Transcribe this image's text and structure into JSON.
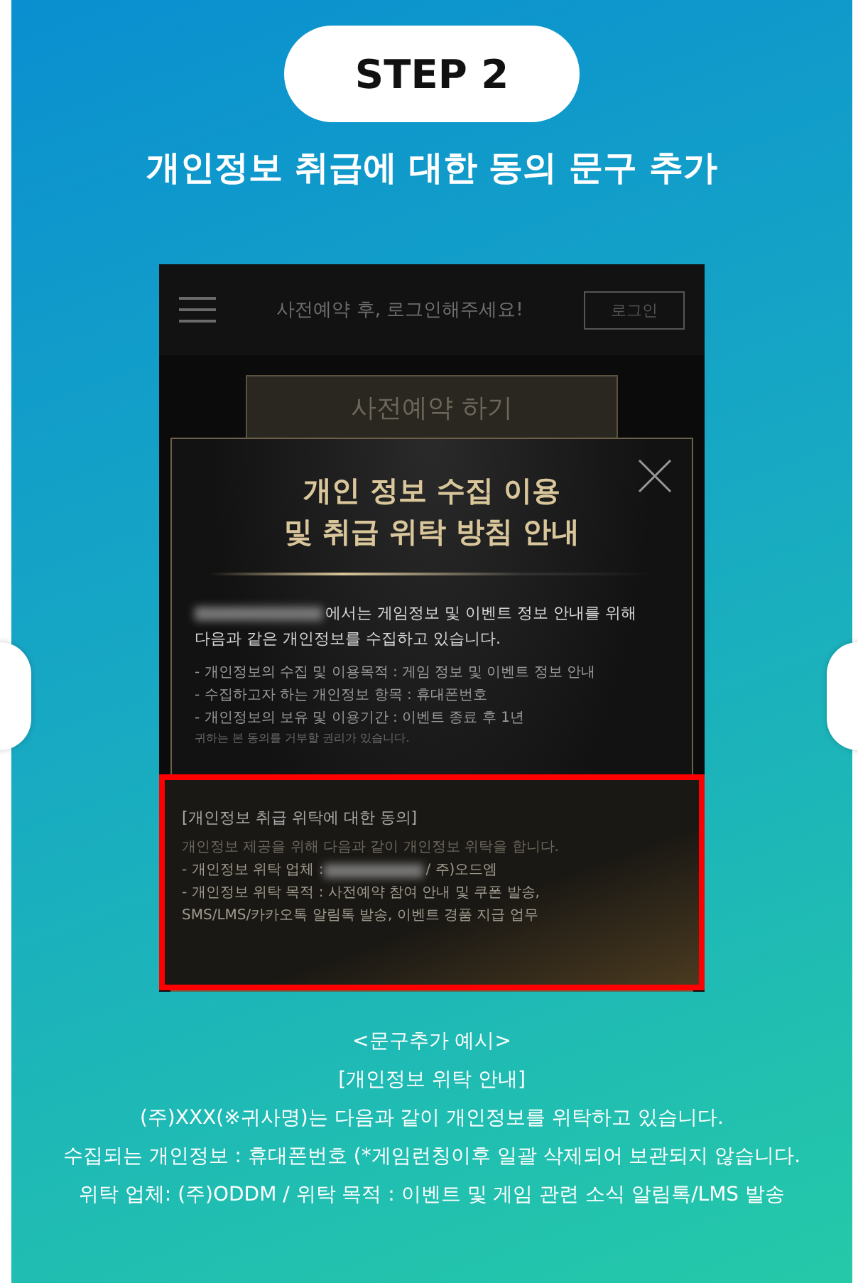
{
  "step_badge": "STEP 2",
  "heading": "개인정보 취급에 대한 동의 문구 추가",
  "phone_screen": {
    "header_text": "사전예약 후, 로그인해주세요!",
    "login_button": "로그인",
    "reserve_button": "사전예약 하기",
    "modal": {
      "title_lines": [
        "개인 정보 수집 이용",
        "및 취급 위탁 방침 안내"
      ],
      "intro_lines": [
        {
          "redacted_prefix": true,
          "text": "에서는 게임정보 및 이벤트 정보 안내를 위해"
        },
        {
          "redacted_prefix": false,
          "text": "다음과 같은 개인정보를 수집하고 있습니다."
        }
      ],
      "items": [
        "- 개인정보의 수집 및 이용목적 : 게임 정보 및 이벤트 정보 안내",
        "- 수집하고자 하는 개인정보 항목 : 휴대폰번호",
        "- 개인정보의 보유 및 이용기간 : 이벤트 종료 후 1년"
      ],
      "fine_print": "귀하는 본 동의를 거부할 권리가 있습니다.",
      "highlight": {
        "title": "[개인정보 취급 위탁에 대한 동의]",
        "lines": [
          {
            "redacted_prefix": false,
            "text": "개인정보 제공을 위해 다음과 같이 개인정보 위탁을 합니다."
          },
          {
            "redacted_prefix": true,
            "label": "- 개인정보 위탁 업체 : ",
            "text": "/ 주)오드엠"
          },
          {
            "redacted_prefix": false,
            "text": "- 개인정보 위탁 목적 : 사전예약 참여 안내 및 쿠폰 발송,"
          },
          {
            "redacted_prefix": false,
            "text": "SMS/LMS/카카오톡 알림톡 발송, 이벤트 경품 지급 업무"
          }
        ]
      }
    }
  },
  "caption_lines": [
    "<문구추가 예시>",
    "[개인정보 위탁 안내]",
    "(주)XXX(※귀사명)는 다음과 같이 개인정보를 위탁하고 있습니다.",
    "수집되는 개인정보 : 휴대폰번호 (*게임런칭이후 일괄 삭제되어 보관되지 않습니다.",
    "위탁 업체: (주)ODDM / 위탁 목적 : 이벤트 및 게임 관련 소식 알림톡/LMS 발송"
  ]
}
